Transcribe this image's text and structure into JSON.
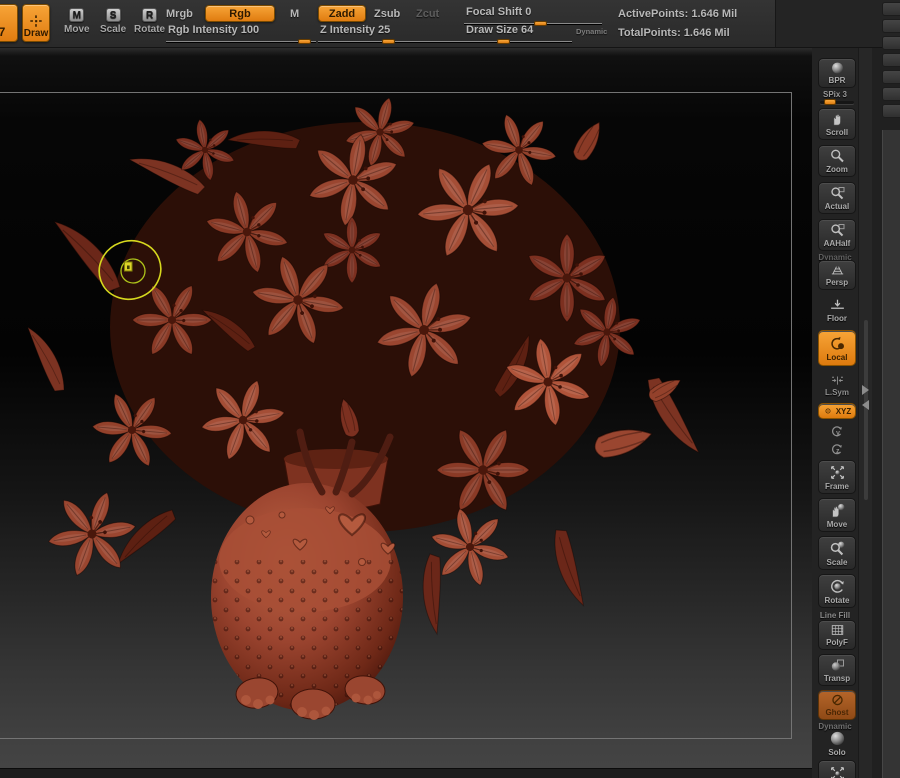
{
  "toolbar": {
    "edge_button_label": "7",
    "tools": [
      {
        "label": "Draw",
        "active": true
      },
      {
        "label": "Move",
        "badge": "M"
      },
      {
        "label": "Scale",
        "badge": "S"
      },
      {
        "label": "Rotate",
        "badge": "R"
      }
    ],
    "paint_modes": [
      {
        "label": "Mrgb",
        "active": false
      },
      {
        "label": "Rgb",
        "active": true
      },
      {
        "label": "M",
        "active": false
      }
    ],
    "sculpt_modes": [
      {
        "label": "Zadd",
        "active": true
      },
      {
        "label": "Zsub",
        "active": false
      },
      {
        "label": "Zcut",
        "disabled": true
      }
    ],
    "sliders": {
      "rgb_intensity": {
        "label": "Rgb Intensity 100",
        "value_pct": 92
      },
      "z_intensity": {
        "label": "Z Intensity 25",
        "value_pct": 43
      },
      "focal_shift": {
        "label": "Focal Shift 0",
        "value_pct": 55
      },
      "draw_size": {
        "label": "Draw Size 64",
        "value_pct": 36
      }
    },
    "dynamic_label": "Dynamic",
    "stats": {
      "active_points": "ActivePoints: 1.646 Mil",
      "total_points": "TotalPoints: 1.646 Mil"
    }
  },
  "shelf": {
    "items": [
      {
        "label": "BPR",
        "icon": "render-sphere-icon"
      },
      {
        "label": "SPix 3",
        "icon": "spix-slider",
        "value_pct": 30
      },
      {
        "label": "Scroll",
        "icon": "hand-icon"
      },
      {
        "label": "Zoom",
        "icon": "magnifier-icon"
      },
      {
        "label": "Actual",
        "icon": "magnifier-doc-icon"
      },
      {
        "label": "AAHalf",
        "icon": "magnifier-doc-icon"
      },
      {
        "label": "Persp",
        "icon": "perspective-grid-icon",
        "overlay": "Dynamic"
      },
      {
        "label": "Floor",
        "icon": "floor-icon"
      },
      {
        "label": "Local",
        "icon": "local-pivot-icon",
        "active": true
      },
      {
        "label": "L.Sym",
        "icon": "local-symmetry-icon"
      },
      {
        "label": "XYZ",
        "icon": "axis-icon",
        "active": true
      },
      {
        "icon": "rotate-y-icon"
      },
      {
        "icon": "rotate-z-icon"
      },
      {
        "label": "Frame",
        "icon": "frame-icon"
      },
      {
        "label": "Move",
        "icon": "hand-sphere-icon"
      },
      {
        "label": "Scale",
        "icon": "magnifier-sphere-icon"
      },
      {
        "label": "Rotate",
        "icon": "rotate-sphere-icon"
      },
      {
        "heading": "Line Fill",
        "label": "PolyF",
        "icon": "polyframe-grid-icon"
      },
      {
        "label": "Transp",
        "icon": "transparency-icon"
      },
      {
        "label": "Ghost",
        "icon": "ghost-slash-icon",
        "active": true
      },
      {
        "heading": "Dynamic",
        "label": "Solo",
        "icon": "solo-sphere-icon"
      }
    ]
  },
  "canvas": {
    "model": "sculpted lily bouquet in decorated vase",
    "cursor_color": "#d6d81e"
  },
  "colors": {
    "accent_orange": "#ee8c1d",
    "clay": "#9a4630",
    "canvas_top": "#030303",
    "canvas_bottom": "#454545"
  }
}
